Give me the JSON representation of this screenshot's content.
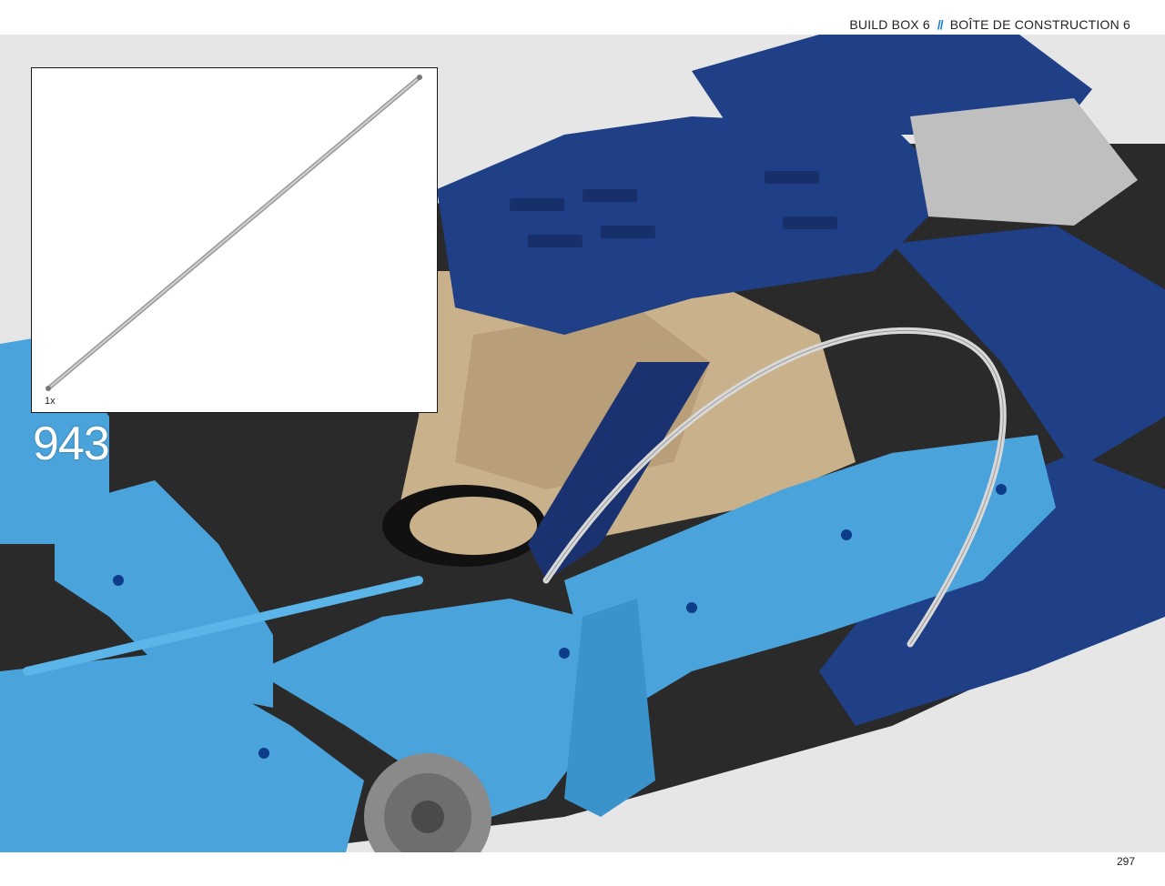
{
  "header": {
    "left_text": "BUILD BOX 6",
    "separator": "//",
    "right_text": "BOÎTE DE CONSTRUCTION 6"
  },
  "callout": {
    "quantity": "1x",
    "part_icon": "flexible-axle-icon"
  },
  "step": {
    "number": "943"
  },
  "footer": {
    "page_number": "297"
  },
  "colors": {
    "accent": "#1a7fd1",
    "light_blue": "#4aa3db",
    "dark_blue": "#1f3f86",
    "tan": "#c9b18c",
    "black": "#1c1c1c",
    "background": "#e6e6e6"
  }
}
